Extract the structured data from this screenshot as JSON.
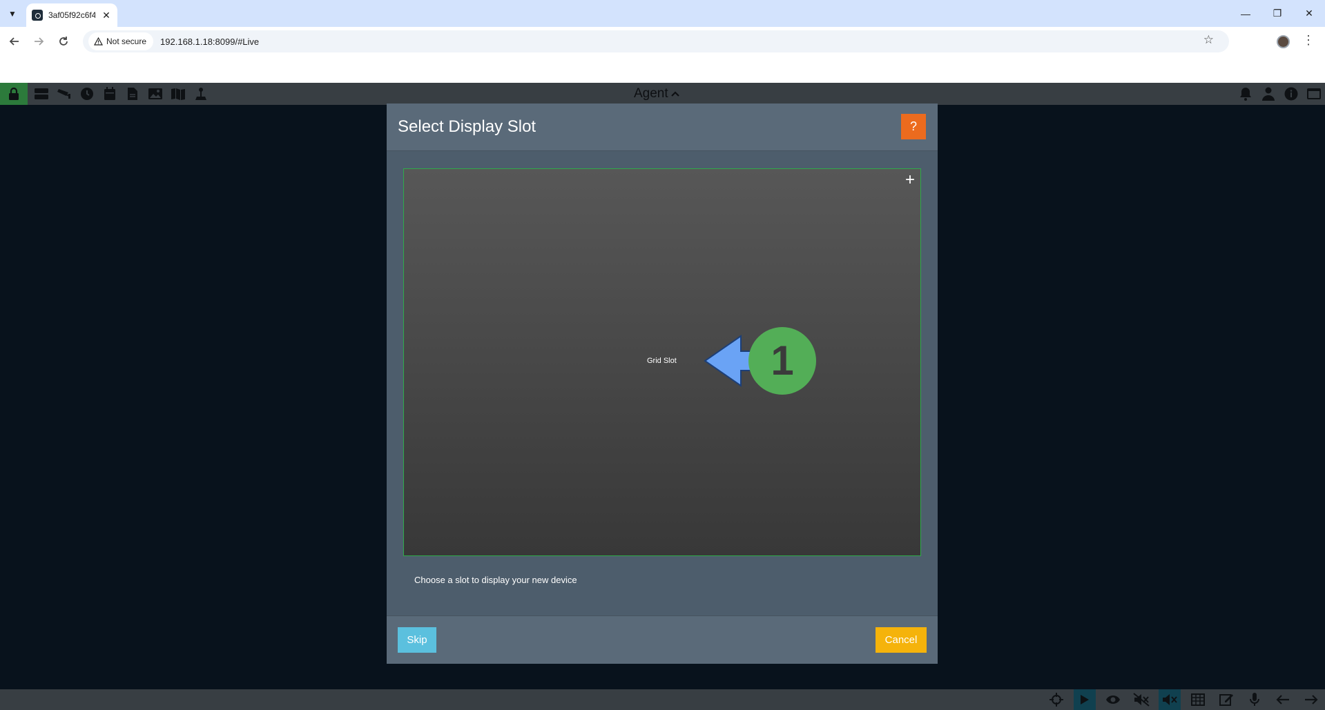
{
  "browser": {
    "tab_title": "3af05f92c6f4",
    "security_label": "Not secure",
    "url": "192.168.1.18:8099/#Live"
  },
  "app": {
    "title": "Agent"
  },
  "modal": {
    "title": "Select Display Slot",
    "help_label": "?",
    "add_label": "+",
    "slot_label": "Grid Slot",
    "annotation_number": "1",
    "hint": "Choose a slot to display your new device",
    "skip_label": "Skip",
    "cancel_label": "Cancel"
  },
  "colors": {
    "help": "#ec6b1e",
    "skip": "#5bc0de",
    "cancel": "#f5b30b",
    "grid_border": "#2fab4a",
    "annotation_arrow": "#6aa3f5",
    "annotation_circle": "#53ae57"
  }
}
